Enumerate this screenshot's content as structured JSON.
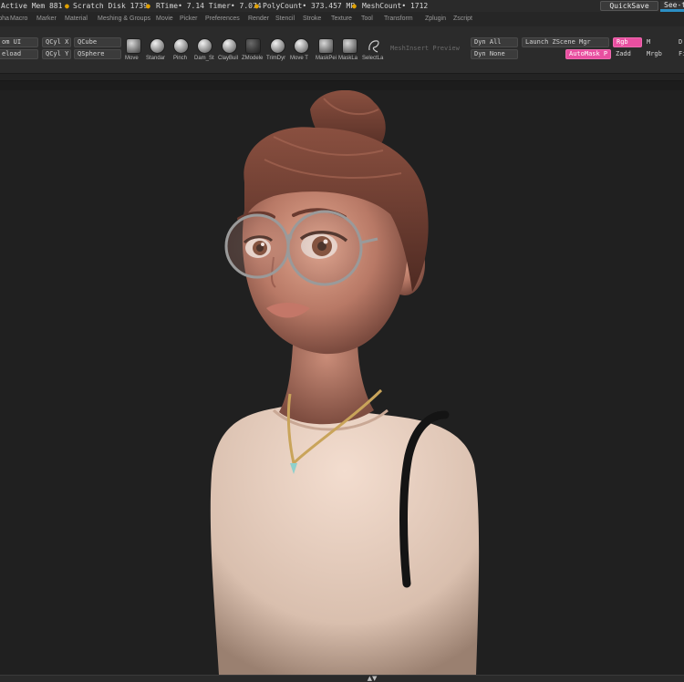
{
  "status": {
    "active_mem": "Active Mem 881",
    "scratch_disk": "Scratch Disk 1739",
    "rtime": "RTime• 7.14 Timer• 7.074",
    "polycount": "PolyCount• 373.457 MP",
    "meshcount": "MeshCount• 1712",
    "quicksave": "QuickSave",
    "seethrough": "See-t"
  },
  "menu": [
    "Alpha",
    "Macro",
    "Marker",
    "Material",
    "Meshing & Groups",
    "Movie",
    "Picker",
    "Preferences",
    "Render",
    "Stencil",
    "Stroke",
    "Texture",
    "Tool",
    "Transform",
    "Zplugin",
    "Zscript"
  ],
  "toolbar": {
    "left": {
      "custom_ui": "om UI",
      "reload": "eload",
      "qcyl_x": "QCyl X",
      "qcyl_y": "QCyl Y",
      "qcube": "QCube",
      "qsphere": "QSphere"
    },
    "brushes": [
      "Move",
      "Standar",
      "Pinch",
      "Dam_St",
      "ClayBuil",
      "ZModele",
      "TrimDyr",
      "Move T",
      "MaskPei",
      "MaskLa",
      "SelectLa"
    ],
    "mesh_insert_preview": "MeshInsert Preview",
    "dyn_all": "Dyn All",
    "dyn_none": "Dyn None",
    "launch_zscene": "Launch ZScene Mgr",
    "rgb": "Rgb",
    "m": "M",
    "automask": "AutoMask P",
    "zadd": "Zadd",
    "mrgb": "Mrgb",
    "d": "D",
    "f": "Fi"
  },
  "colors": {
    "accent_pink": "#e84fa0",
    "accent_blue": "#2c8fc4",
    "status_dot": "#e0a000"
  }
}
